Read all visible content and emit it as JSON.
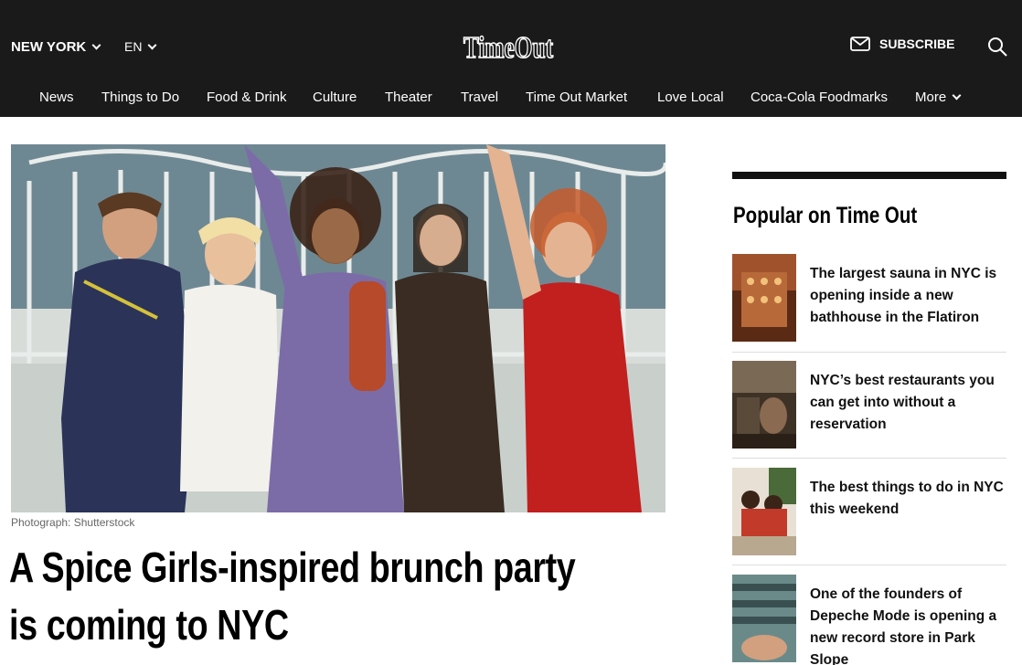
{
  "header": {
    "city": "NEW YORK",
    "language": "EN",
    "logo_text": "TimeOut",
    "subscribe_label": "SUBSCRIBE"
  },
  "nav": {
    "items": [
      "News",
      "Things to Do",
      "Food & Drink",
      "Culture",
      "Theater",
      "Travel",
      "Time Out Market",
      "Love Local",
      "Coca-Cola Foodmarks",
      "More"
    ]
  },
  "article": {
    "photo_credit": "Photograph: Shutterstock",
    "headline_line1": "A Spice Girls-inspired brunch party",
    "headline_line2": "is coming to NYC"
  },
  "sidebar": {
    "title": "Popular on Time Out",
    "items": [
      {
        "title": "The largest sauna in NYC is opening inside a new bathhouse in the Flatiron"
      },
      {
        "title": "NYC’s best restaurants you can get into without a reservation"
      },
      {
        "title": "The best things to do in NYC this weekend"
      },
      {
        "title": "One of the founders of Depeche Mode is opening a new record store in Park Slope"
      }
    ]
  },
  "colors": {
    "header_bg": "#1a1a1a",
    "text": "#000000",
    "accent_dress": "#c21f1f"
  },
  "icons": [
    "chevron-down-icon",
    "mail-icon",
    "search-icon"
  ]
}
